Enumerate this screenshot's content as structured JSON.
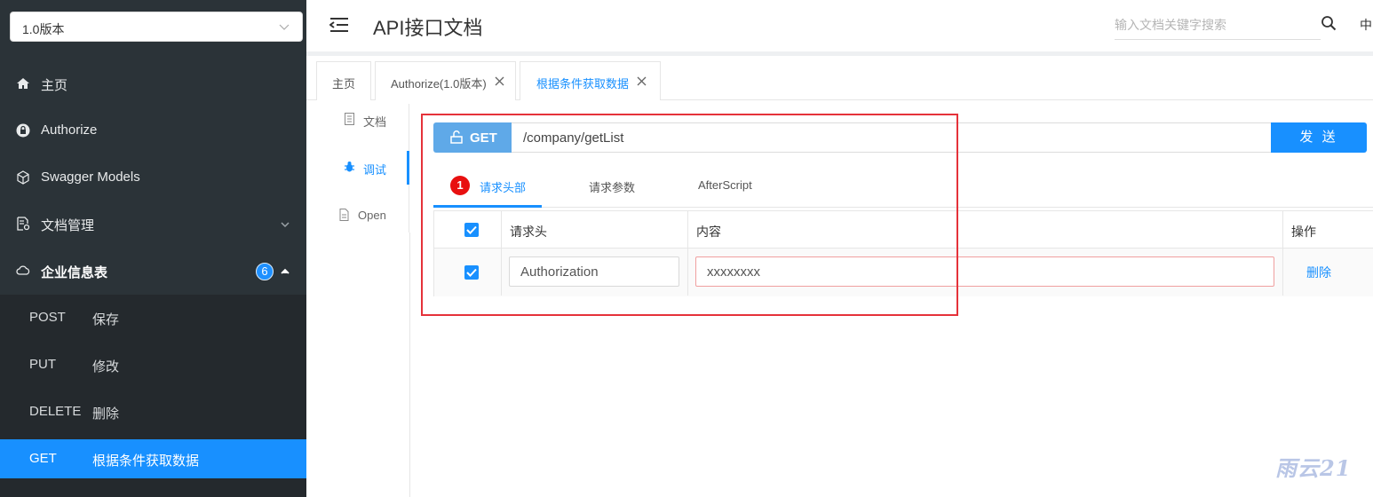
{
  "sidebar": {
    "version": "1.0版本",
    "items": [
      {
        "label": "主页",
        "icon": "home-icon"
      },
      {
        "label": "Authorize",
        "icon": "lock-icon"
      },
      {
        "label": "Swagger Models",
        "icon": "cube-icon"
      },
      {
        "label": "文档管理",
        "icon": "doc-settings-icon"
      },
      {
        "label": "企业信息表",
        "icon": "cloud-icon",
        "badge": "6"
      }
    ],
    "sub_items": [
      {
        "method": "POST",
        "label": "保存"
      },
      {
        "method": "PUT",
        "label": "修改"
      },
      {
        "method": "DELETE",
        "label": "删除"
      },
      {
        "method": "GET",
        "label": "根据条件获取数据"
      }
    ]
  },
  "header": {
    "title": "API接口文档",
    "search_placeholder": "输入文档关键字搜索",
    "lang": "中"
  },
  "tabs": [
    {
      "label": "主页"
    },
    {
      "label": "Authorize(1.0版本)"
    },
    {
      "label": "根据条件获取数据"
    }
  ],
  "subnav": [
    {
      "label": "文档"
    },
    {
      "label": "调试"
    },
    {
      "label": "Open"
    }
  ],
  "request": {
    "method": "GET",
    "url": "/company/getList",
    "send_label": "发 送",
    "tabs": [
      {
        "label": "请求头部",
        "badge": "1"
      },
      {
        "label": "请求参数"
      },
      {
        "label": "AfterScript"
      }
    ],
    "table": {
      "headers": [
        "请求头",
        "内容",
        "操作"
      ],
      "rows": [
        {
          "name": "Authorization",
          "value": "xxxxxxxx",
          "action": "删除"
        }
      ]
    }
  },
  "watermark": "雨云21",
  "colors": {
    "sidebar_bg": "#2b3338",
    "accent": "#1890ff",
    "highlight_box": "#e5323a"
  }
}
